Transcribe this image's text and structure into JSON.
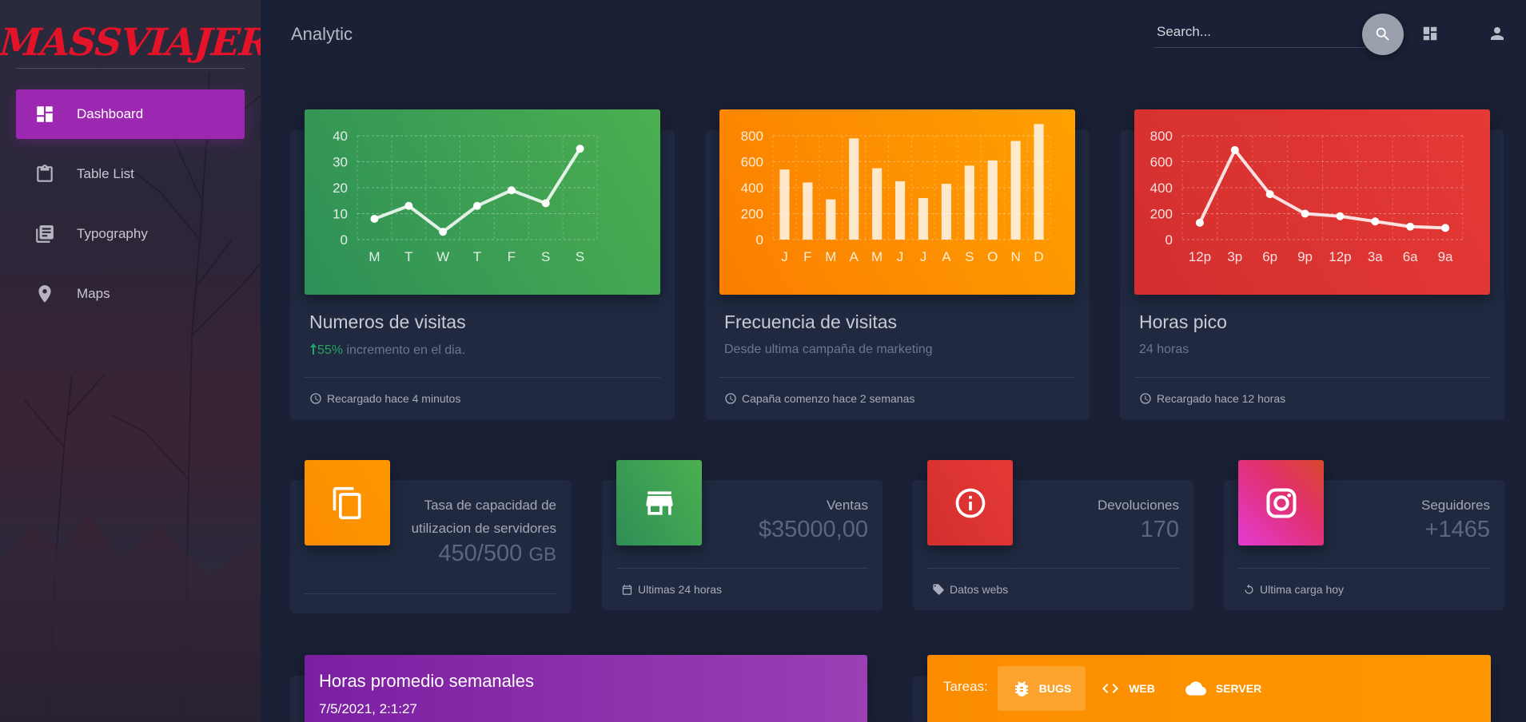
{
  "sidebar": {
    "brand": "MASSVIAJEROS",
    "items": [
      {
        "label": "Dashboard",
        "icon": "dashboard-icon",
        "active": true
      },
      {
        "label": "Table List",
        "icon": "clipboard-icon",
        "active": false
      },
      {
        "label": "Typography",
        "icon": "library-books-icon",
        "active": false
      },
      {
        "label": "Maps",
        "icon": "location-pin-icon",
        "active": false
      }
    ]
  },
  "header": {
    "title": "Analytic",
    "search_placeholder": "Search...",
    "search_icon": "search-icon",
    "apps_icon": "dashboard-icon",
    "user_icon": "person-icon"
  },
  "chart_cards": [
    {
      "title": "Numeros de visitas",
      "highlight": "55%",
      "subtitle": " incremento en el dia.",
      "footer": "Recargado hace 4 minutos",
      "footer_icon": "clock-icon",
      "color": "#43a047"
    },
    {
      "title": "Frecuencia de visitas",
      "subtitle": "Desde ultima campaña de marketing",
      "footer": "Capaña comenzo hace 2 semanas",
      "footer_icon": "clock-icon",
      "color": "#fb8c00"
    },
    {
      "title": "Horas pico",
      "subtitle": "24 horas",
      "footer": "Recargado hace 12 horas",
      "footer_icon": "clock-icon",
      "color": "#e53935"
    }
  ],
  "chart_data": [
    {
      "type": "line",
      "categories": [
        "M",
        "T",
        "W",
        "T",
        "F",
        "S",
        "S"
      ],
      "values": [
        8,
        13,
        3,
        13,
        19,
        14,
        35
      ],
      "ylim": [
        0,
        40
      ],
      "yticks": [
        0,
        10,
        20,
        30,
        40
      ],
      "title": "",
      "xlabel": "",
      "ylabel": ""
    },
    {
      "type": "bar",
      "categories": [
        "J",
        "F",
        "M",
        "A",
        "M",
        "J",
        "J",
        "A",
        "S",
        "O",
        "N",
        "D"
      ],
      "values": [
        540,
        440,
        310,
        780,
        550,
        450,
        320,
        430,
        570,
        610,
        760,
        890
      ],
      "ylim": [
        0,
        800
      ],
      "yticks": [
        0,
        200,
        400,
        600,
        800
      ],
      "title": "",
      "xlabel": "",
      "ylabel": ""
    },
    {
      "type": "line",
      "categories": [
        "12p",
        "3p",
        "6p",
        "9p",
        "12p",
        "3a",
        "6a",
        "9a"
      ],
      "values": [
        130,
        690,
        350,
        200,
        180,
        140,
        100,
        90
      ],
      "ylim": [
        0,
        800
      ],
      "yticks": [
        0,
        200,
        400,
        600,
        800
      ],
      "title": "",
      "xlabel": "",
      "ylabel": ""
    }
  ],
  "stat_cards": [
    {
      "label": "Tasa de capacidad de utilizacion de servidores",
      "value": "450/500",
      "unit": "GB",
      "icon": "copy-icon",
      "color": "#fb8c00",
      "footer": ""
    },
    {
      "label": "Ventas",
      "value": "$35000,00",
      "icon": "store-icon",
      "color": "#43a047",
      "footer": "Ultimas 24 horas",
      "footer_icon": "calendar-icon"
    },
    {
      "label": "Devoluciones",
      "value": "170",
      "icon": "info-icon",
      "color": "#e53935",
      "footer": "Datos webs",
      "footer_icon": "tag-icon"
    },
    {
      "label": "Seguidores",
      "value": "+1465",
      "icon": "instagram-icon",
      "color": "#e1306c",
      "footer": "Ultima carga hoy",
      "footer_icon": "refresh-icon"
    }
  ],
  "hours_card": {
    "title": "Horas promedio semanales",
    "date": "7/5/2021, 2:1:27"
  },
  "tasks_card": {
    "label": "Tareas:",
    "tabs": [
      {
        "label": "BUGS",
        "icon": "bug-icon",
        "active": true
      },
      {
        "label": "WEB",
        "icon": "code-icon",
        "active": false
      },
      {
        "label": "SERVER",
        "icon": "cloud-icon",
        "active": false
      }
    ]
  }
}
